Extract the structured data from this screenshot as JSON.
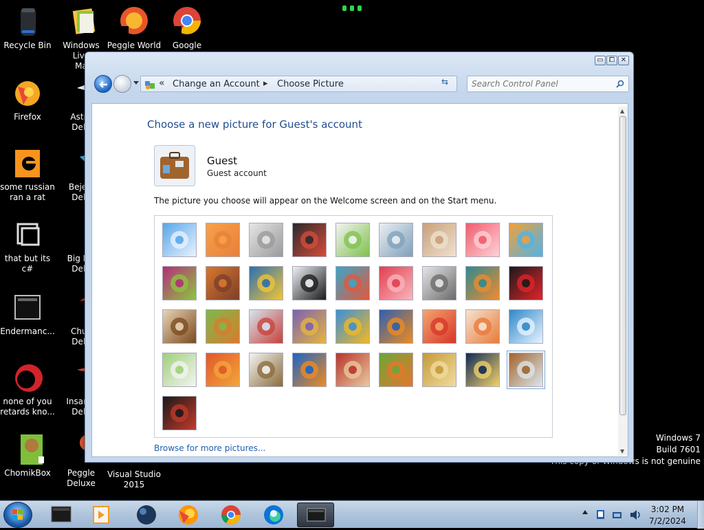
{
  "desktop": {
    "icons": [
      {
        "label": "Recycle Bin",
        "icon": "recycle-bin-icon"
      },
      {
        "label": "Windows Live\nMa",
        "icon": "windows-live-mail-icon"
      },
      {
        "label": "Peggle World",
        "icon": "peggle-world-icon"
      },
      {
        "label": "Google",
        "icon": "google-chrome-icon"
      },
      {
        "label": "Firefox",
        "icon": "firefox-icon"
      },
      {
        "label": "Astro\nDelu",
        "icon": "astro-deluxe-icon"
      },
      {
        "label": "some russian\nran a rat",
        "icon": "orange-e-icon"
      },
      {
        "label": "Bejew\nDelu",
        "icon": "bejeweled-deluxe-icon"
      },
      {
        "label": "that but its c#",
        "icon": "shortcut-icon"
      },
      {
        "label": "Big Mo\nDelu",
        "icon": "big-money-deluxe-icon"
      },
      {
        "label": "Endermanc...",
        "icon": "endermanch-icon"
      },
      {
        "label": "Chuz\nDelu",
        "icon": "chuzzle-deluxe-icon"
      },
      {
        "label": "none of you\nretards kno...",
        "icon": "red-circle-icon"
      },
      {
        "label": "Insaniq\nDelu",
        "icon": "insaniquarium-deluxe-icon"
      },
      {
        "label": "ChomikBox",
        "icon": "chomikbox-icon"
      },
      {
        "label": "Peggle Deluxe",
        "icon": "peggle-deluxe-icon"
      },
      {
        "label": "Visual Studio\n2015",
        "icon": "visual-studio-icon"
      }
    ],
    "watermark": [
      "Windows 7",
      "Build 7601",
      "This copy of Windows is not genuine"
    ]
  },
  "window": {
    "breadcrumb": {
      "chevrons": "«",
      "items": [
        "Change an Account",
        "Choose Picture"
      ],
      "separator": "▸"
    },
    "search": {
      "placeholder": "Search Control Panel"
    },
    "caption_buttons": {
      "minimize": "▭",
      "maximize": "⧠",
      "close": "✕"
    },
    "page_title": "Choose a new picture for Guest's account",
    "account": {
      "name": "Guest",
      "type": "Guest account"
    },
    "description": "The picture you choose will appear on the Welcome screen and on the Start menu.",
    "pictures": [
      "roller-coaster",
      "starfish",
      "robot-toy",
      "record-player",
      "lucky-cat",
      "gyroscope",
      "kitten",
      "flower",
      "pinwheel",
      "ball",
      "fabric",
      "leaf",
      "dog",
      "crayons",
      "star",
      "jacks",
      "stairs",
      "paper-crane",
      "guitar",
      "puppy",
      "tin-robot",
      "shawl",
      "sunflower",
      "fish",
      "balloon",
      "daruma",
      "sailboat",
      "soccer-ball",
      "scarf",
      "marbles",
      "window",
      "rug",
      "butterfly",
      "shell",
      "lighthouse",
      "suitcase",
      "terminal"
    ],
    "selected_picture": "suitcase",
    "browse_link": "Browse for more pictures..."
  },
  "taskbar": {
    "apps": [
      "cmd-app",
      "media-player",
      "sphere-app",
      "firefox",
      "chrome",
      "edge",
      "active-window"
    ],
    "clock": {
      "time": "3:02 PM",
      "date": "7/2/2024"
    }
  },
  "colors": {
    "title_blue": "#1f4d8f",
    "link_blue": "#1f5fb0",
    "taskbar": "#aec4dc"
  }
}
